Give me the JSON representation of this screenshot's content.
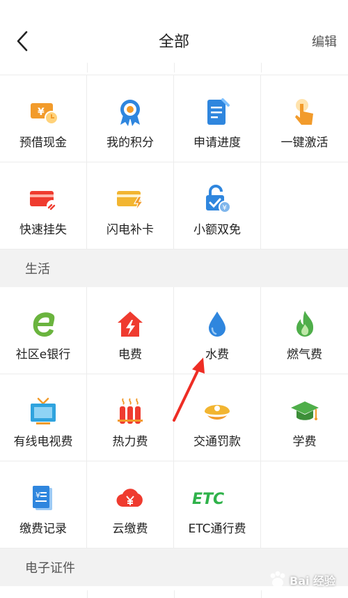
{
  "header": {
    "title": "全部",
    "edit_label": "编辑"
  },
  "section1": {
    "items": [
      {
        "label": "预借现金",
        "icon": "cash-advance-icon"
      },
      {
        "label": "我的积分",
        "icon": "points-medal-icon"
      },
      {
        "label": "申请进度",
        "icon": "application-progress-icon"
      },
      {
        "label": "一键激活",
        "icon": "one-tap-activate-icon"
      },
      {
        "label": "快速挂失",
        "icon": "card-loss-report-icon"
      },
      {
        "label": "闪电补卡",
        "icon": "card-replace-icon"
      },
      {
        "label": "小额双免",
        "icon": "small-payment-lock-icon"
      }
    ]
  },
  "life": {
    "title": "生活",
    "items": [
      {
        "label": "社区e银行",
        "icon": "community-e-bank-icon"
      },
      {
        "label": "电费",
        "icon": "electricity-house-icon"
      },
      {
        "label": "水费",
        "icon": "water-drop-icon"
      },
      {
        "label": "燃气费",
        "icon": "gas-flame-icon"
      },
      {
        "label": "有线电视费",
        "icon": "tv-icon"
      },
      {
        "label": "热力费",
        "icon": "heating-radiator-icon"
      },
      {
        "label": "交通罚款",
        "icon": "police-cap-icon"
      },
      {
        "label": "学费",
        "icon": "graduation-cap-icon"
      },
      {
        "label": "缴费记录",
        "icon": "payment-record-icon"
      },
      {
        "label": "云缴费",
        "icon": "cloud-payment-icon"
      },
      {
        "label": "ETC通行费",
        "icon": "etc-toll-icon",
        "badge": "ETC"
      }
    ]
  },
  "ecert": {
    "title": "电子证件"
  },
  "watermark": {
    "text": "Bai 经验"
  },
  "colors": {
    "accent_red": "#ef3b2f",
    "orange": "#f29b2b",
    "blue": "#2f86de",
    "green": "#4fae4a"
  }
}
